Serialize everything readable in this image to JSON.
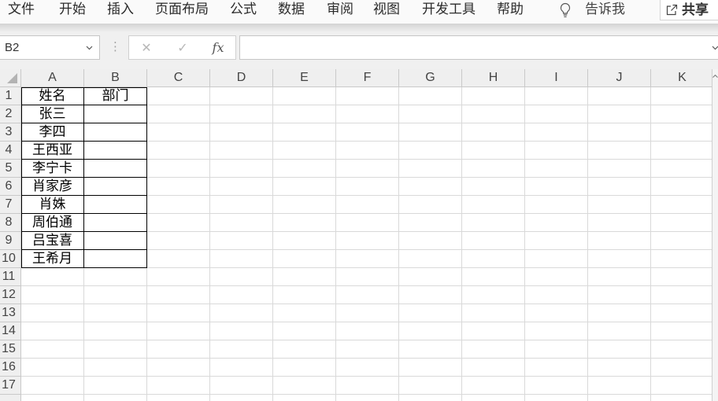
{
  "ribbon": {
    "tabs": [
      "文件",
      "开始",
      "插入",
      "页面布局",
      "公式",
      "数据",
      "审阅",
      "视图",
      "开发工具",
      "帮助"
    ],
    "tell_me": {
      "label": "告诉我",
      "icon": "lightbulb-icon"
    },
    "share": {
      "label": "共享",
      "icon": "share-icon"
    }
  },
  "formula_bar": {
    "name_box": "B2",
    "name_box_icon": "chevron-down-icon",
    "separator": "⋮",
    "cancel": "✕",
    "enter": "✓",
    "insert_function": "fx",
    "formula": "",
    "expand_icon": "chevron-down-icon"
  },
  "sheet": {
    "columns": [
      "A",
      "B",
      "C",
      "D",
      "E",
      "F",
      "G",
      "H",
      "I",
      "J",
      "K"
    ],
    "rows": [
      "1",
      "2",
      "3",
      "4",
      "5",
      "6",
      "7",
      "8",
      "9",
      "10",
      "11",
      "12",
      "13",
      "14",
      "15",
      "16",
      "17"
    ],
    "cells": {
      "A1": "姓名",
      "B1": "部门",
      "A2": "张三",
      "A3": "李四",
      "A4": "王西亚",
      "A5": "李宁卡",
      "A6": "肖家彦",
      "A7": "肖姝",
      "A8": "周伯通",
      "A9": "吕宝喜",
      "A10": "王希月"
    }
  },
  "colors": {
    "gridline": "#d9d9d9",
    "cell_border": "#000000",
    "header_bg": "#efefef",
    "header_line": "#c9c9c9",
    "header_text": "#444444"
  }
}
